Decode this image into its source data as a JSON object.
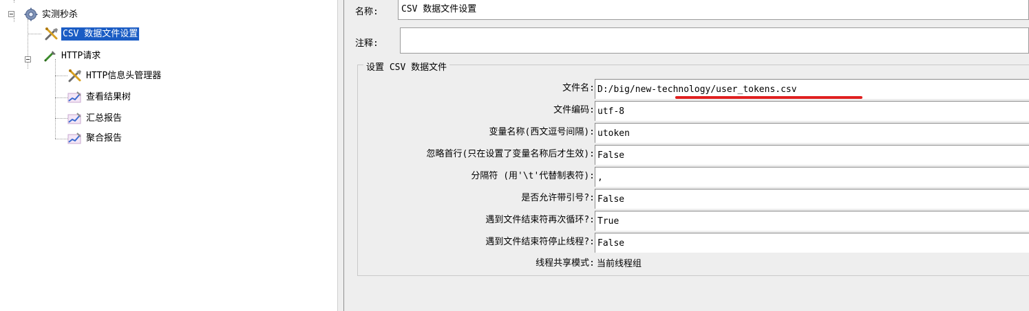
{
  "tree": {
    "root_label": "实测秒杀",
    "items": [
      {
        "label": "CSV 数据文件设置",
        "icon": "wrench-icon",
        "selected": true
      },
      {
        "label": "HTTP请求",
        "icon": "pipette-icon"
      },
      {
        "label": "HTTP信息头管理器",
        "icon": "wrench-icon"
      },
      {
        "label": "查看结果树",
        "icon": "graph-icon"
      },
      {
        "label": "汇总报告",
        "icon": "graph-icon"
      },
      {
        "label": "聚合报告",
        "icon": "graph-icon"
      }
    ]
  },
  "panel": {
    "name_label": "名称:",
    "name_value": "CSV 数据文件设置",
    "comment_label": "注释:",
    "comment_value": "",
    "section_title": "设置 CSV 数据文件",
    "fields": [
      {
        "label": "文件名:",
        "value": "D:/big/new-technology/user_tokens.csv"
      },
      {
        "label": "文件编码:",
        "value": "utf-8"
      },
      {
        "label": "变量名称(西文逗号间隔):",
        "value": "utoken"
      },
      {
        "label": "忽略首行(只在设置了变量名称后才生效):",
        "value": "False"
      },
      {
        "label": "分隔符 (用'\\t'代替制表符):",
        "value": ","
      },
      {
        "label": "是否允许带引号?:",
        "value": "False"
      },
      {
        "label": "遇到文件结束符再次循环?:",
        "value": "True"
      },
      {
        "label": "遇到文件结束符停止线程?:",
        "value": "False"
      },
      {
        "label": "线程共享模式:",
        "value": "当前线程组"
      }
    ]
  },
  "colors": {
    "selection": "#1a5cc4",
    "annotation_underline": "#e02020",
    "panel_bg": "#eeeeee"
  }
}
